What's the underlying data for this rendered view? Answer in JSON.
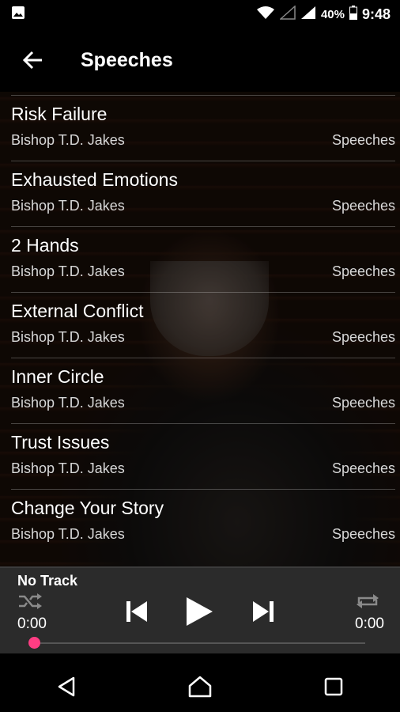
{
  "status_bar": {
    "battery": "40%",
    "time": "9:48",
    "icons": [
      "image-icon",
      "wifi-icon",
      "signal-icon",
      "signal-icon",
      "battery-icon"
    ]
  },
  "app_bar": {
    "title": "Speeches",
    "back_icon": "arrow-left-icon"
  },
  "tracks": [
    {
      "name": "Risk Failure",
      "artist": "Bishop T.D. Jakes",
      "album": "Speeches"
    },
    {
      "name": "Exhausted Emotions",
      "artist": "Bishop T.D. Jakes",
      "album": "Speeches"
    },
    {
      "name": "2 Hands",
      "artist": "Bishop T.D. Jakes",
      "album": "Speeches"
    },
    {
      "name": "External Conflict",
      "artist": "Bishop T.D. Jakes",
      "album": "Speeches"
    },
    {
      "name": "Inner Circle",
      "artist": "Bishop T.D. Jakes",
      "album": "Speeches"
    },
    {
      "name": "Trust Issues",
      "artist": "Bishop T.D. Jakes",
      "album": "Speeches"
    },
    {
      "name": "Change Your Story",
      "artist": "Bishop T.D. Jakes",
      "album": "Speeches"
    }
  ],
  "player": {
    "track_title": "No Track",
    "current_time": "0:00",
    "total_time": "0:00",
    "progress": 0,
    "accent_color": "#ff3d83"
  },
  "nav_bar": {
    "icons": [
      "back-triangle-icon",
      "home-icon",
      "recents-icon"
    ]
  }
}
